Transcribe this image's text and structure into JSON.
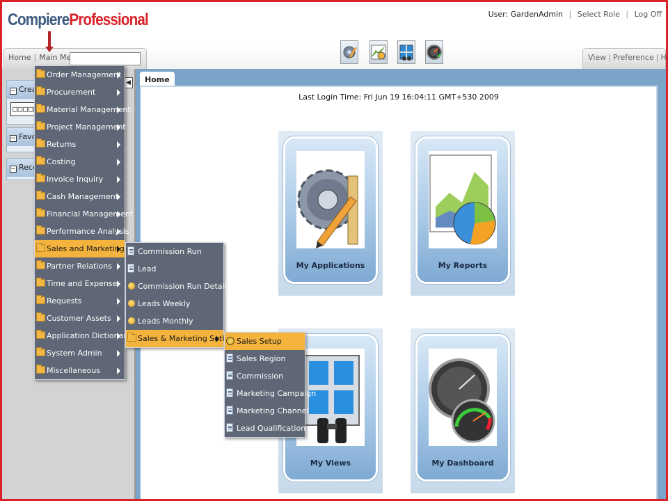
{
  "header": {
    "logo_part1": "Compiere",
    "logo_part2": "Professional",
    "user_label": "User: GardenAdmin",
    "select_role": "Select Role",
    "log_off": "Log Off"
  },
  "nav": {
    "home": "Home",
    "main_menu": "Main Menu",
    "search_value": "",
    "view": "View",
    "preference": "Preference",
    "help": "Help",
    "toolbar_icons": [
      "applications-icon",
      "reports-icon",
      "views-icon",
      "dashboard-icon"
    ]
  },
  "left_panel": {
    "create_label": "Create",
    "create_value": "□□□□□",
    "favorites_label": "Favorites",
    "recent_label": "Recent"
  },
  "content": {
    "tab_home": "Home",
    "last_login": "Last Login Time: Fri Jun 19 16:04:11 GMT+530 2009",
    "tiles": [
      {
        "label": "My Applications",
        "icon": "gear-pencil-icon"
      },
      {
        "label": "My Reports",
        "icon": "chart-icon"
      },
      {
        "label": "My Views",
        "icon": "window-binoculars-icon"
      },
      {
        "label": "My Dashboard",
        "icon": "gauge-icon"
      }
    ]
  },
  "main_menu": {
    "items": [
      {
        "label": "Order Management"
      },
      {
        "label": "Procurement"
      },
      {
        "label": "Material Management"
      },
      {
        "label": "Project Management"
      },
      {
        "label": "Returns"
      },
      {
        "label": "Costing"
      },
      {
        "label": "Invoice Inquiry"
      },
      {
        "label": "Cash Management"
      },
      {
        "label": "Financial Management"
      },
      {
        "label": "Performance Analysis"
      },
      {
        "label": "Sales and Marketing",
        "active": true
      },
      {
        "label": "Partner Relations"
      },
      {
        "label": "Time and Expense"
      },
      {
        "label": "Requests"
      },
      {
        "label": "Customer Assets"
      },
      {
        "label": "Application Dictionary"
      },
      {
        "label": "System Admin"
      },
      {
        "label": "Miscellaneous"
      }
    ]
  },
  "sales_menu": {
    "items": [
      {
        "label": "Commission Run",
        "icon": "document-icon"
      },
      {
        "label": "Lead",
        "icon": "document-icon"
      },
      {
        "label": "Commission Run Detail",
        "icon": "report-icon"
      },
      {
        "label": "Leads Weekly",
        "icon": "report-icon"
      },
      {
        "label": "Leads Monthly",
        "icon": "report-icon"
      },
      {
        "label": "Sales & Marketing SetUp",
        "icon": "folder-icon",
        "active": true
      }
    ]
  },
  "setup_menu": {
    "items": [
      {
        "label": "Sales Setup",
        "icon": "setup-icon",
        "active": true
      },
      {
        "label": "Sales Region",
        "icon": "document-icon"
      },
      {
        "label": "Commission",
        "icon": "document-icon"
      },
      {
        "label": "Marketing Campaign",
        "icon": "document-icon"
      },
      {
        "label": "Marketing Channel",
        "icon": "document-icon"
      },
      {
        "label": "Lead Qualification",
        "icon": "document-icon"
      }
    ]
  }
}
